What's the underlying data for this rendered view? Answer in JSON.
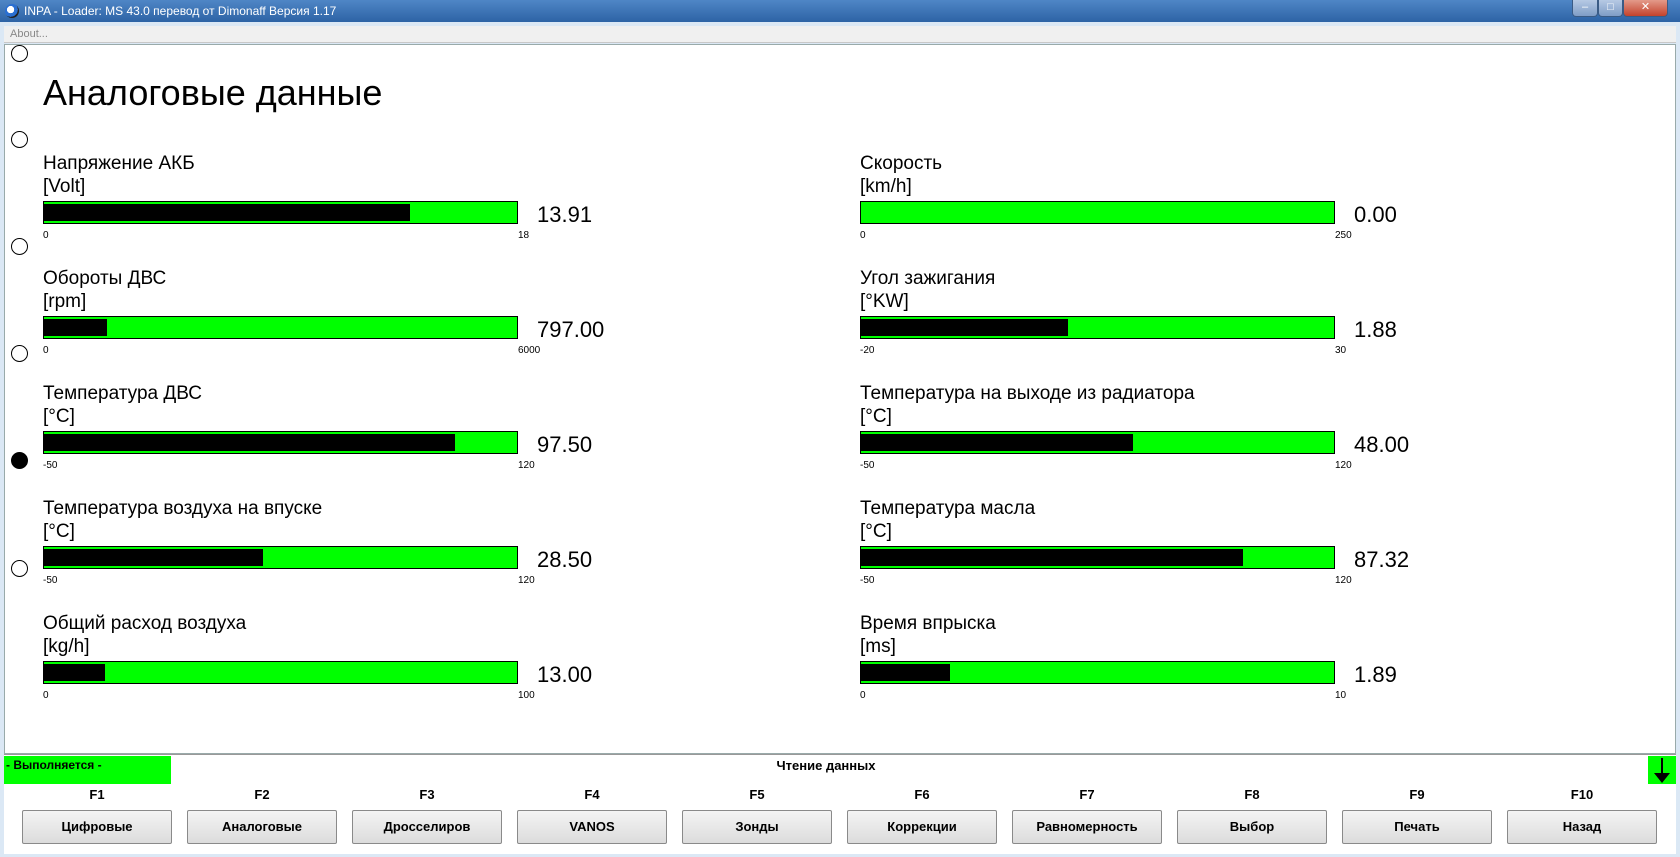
{
  "window": {
    "title": "INPA - Loader:  MS 43.0 перевод от Dimonaff Версия 1.17",
    "min": "–",
    "max": "□",
    "close": "✕"
  },
  "menu": {
    "about": "About..."
  },
  "page": {
    "title": "Аналоговые данные"
  },
  "gauges": [
    {
      "label": "Напряжение АКБ",
      "unit": "[Volt]",
      "value": "13.91",
      "min": "0",
      "max": "18",
      "fill": 0.773
    },
    {
      "label": "Скорость",
      "unit": "[km/h]",
      "value": "0.00",
      "min": "0",
      "max": "250",
      "fill": 0.0
    },
    {
      "label": "Обороты ДВС",
      "unit": "[rpm]",
      "value": "797.00",
      "min": "0",
      "max": "6000",
      "fill": 0.133
    },
    {
      "label": "Угол зажигания",
      "unit": "[°KW]",
      "value": "1.88",
      "min": "-20",
      "max": "30",
      "fill": 0.438
    },
    {
      "label": "Температура ДВС",
      "unit": "[°C]",
      "value": "97.50",
      "min": "-50",
      "max": "120",
      "fill": 0.868
    },
    {
      "label": "Температура на выходе из радиатора",
      "unit": "[°C]",
      "value": "48.00",
      "min": "-50",
      "max": "120",
      "fill": 0.576
    },
    {
      "label": "Температура воздуха на впуске",
      "unit": "[°C]",
      "value": "28.50",
      "min": "-50",
      "max": "120",
      "fill": 0.462
    },
    {
      "label": "Температура масла",
      "unit": "[°C]",
      "value": "87.32",
      "min": "-50",
      "max": "120",
      "fill": 0.808
    },
    {
      "label": "Общий расход воздуха",
      "unit": "[kg/h]",
      "value": "13.00",
      "min": "0",
      "max": "100",
      "fill": 0.13
    },
    {
      "label": "Время впрыска",
      "unit": "[ms]",
      "value": "1.89",
      "min": "0",
      "max": "10",
      "fill": 0.189
    }
  ],
  "status": {
    "running": "- Выполняется -",
    "reading": "Чтение данных"
  },
  "fkeys": [
    {
      "key": "F1",
      "label": "Цифровые"
    },
    {
      "key": "F2",
      "label": "Аналоговые"
    },
    {
      "key": "F3",
      "label": "Дросселиров"
    },
    {
      "key": "F4",
      "label": "VANOS"
    },
    {
      "key": "F5",
      "label": "Зонды"
    },
    {
      "key": "F6",
      "label": "Коррекции"
    },
    {
      "key": "F7",
      "label": "Равномерность"
    },
    {
      "key": "F8",
      "label": "Выбор"
    },
    {
      "key": "F9",
      "label": "Печать"
    },
    {
      "key": "F10",
      "label": "Назад"
    }
  ],
  "colors": {
    "bar": "#00ff00",
    "fill": "#000000",
    "status": "#00ff00"
  }
}
